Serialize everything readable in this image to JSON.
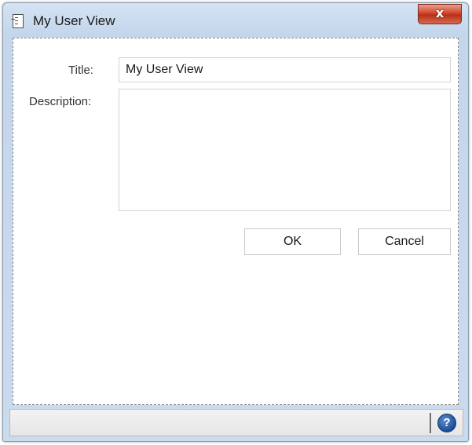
{
  "window": {
    "title": "My User View",
    "close_glyph": "x",
    "title_icon": "document-list-icon"
  },
  "form": {
    "title_label": "Title:",
    "title_value": "My User View",
    "description_label": "Description:",
    "description_value": ""
  },
  "buttons": {
    "ok_label": "OK",
    "cancel_label": "Cancel"
  },
  "status_bar": {
    "help_glyph": "?",
    "help_icon": "help-icon"
  },
  "colors": {
    "titlebar": "#c4d6ec",
    "close_button": "#c8351f",
    "help_icon": "#1c4e96"
  }
}
